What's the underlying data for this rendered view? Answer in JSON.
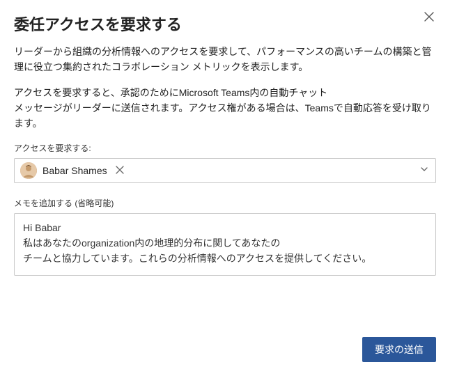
{
  "dialog": {
    "title": "委任アクセスを要求する",
    "description1": "リーダーから組織の分析情報へのアクセスを要求して、パフォーマンスの高いチームの構築と管理に役立つ集約されたコラボレーション メトリックを表示します。",
    "description2": "アクセスを要求すると、承認のためにMicrosoft Teams内の自動チャット\nメッセージがリーダーに送信されます。アクセス権がある場合は、Teamsで自動応答を受け取ります。",
    "access_from_label": "アクセスを要求する:",
    "selected_person": {
      "name": "Babar Shames"
    },
    "note_label": "メモを追加する (省略可能)",
    "note_value": "Hi Babar\n私はあなたのorganization内の地理的分布に関してあなたの\nチームと協力しています。これらの分析情報へのアクセスを提供してください。",
    "submit_label": "要求の送信"
  }
}
